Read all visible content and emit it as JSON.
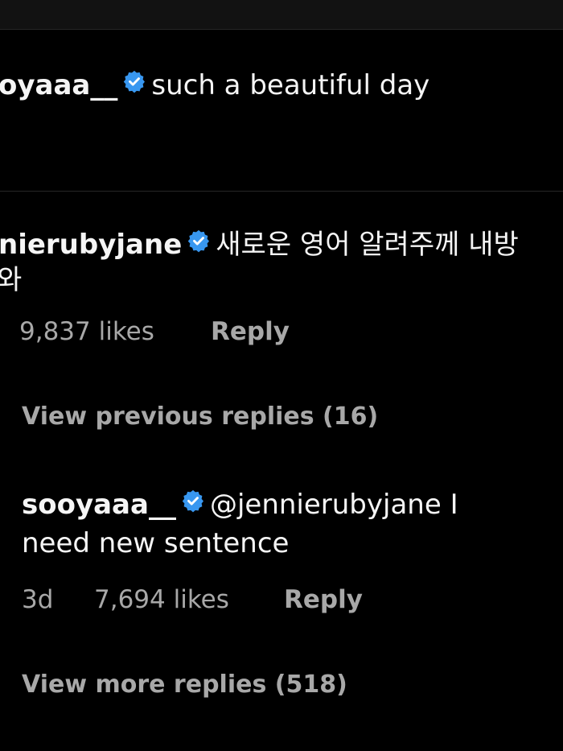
{
  "caption": {
    "username": "oyaaa__",
    "text": "such a beautiful day"
  },
  "comment": {
    "username": "nierubyjane",
    "text_line1": "새로운 영어 알려주께 내방",
    "text_line2": "와",
    "likes": "9,837 likes",
    "reply": "Reply",
    "view_previous": "View previous replies (16)"
  },
  "reply_item": {
    "username": "sooyaaa__",
    "mention": "@jennierubyjane",
    "text_line1_tail": " I",
    "text_line2": "need new sentence",
    "time": "3d",
    "likes": "7,694 likes",
    "reply": "Reply",
    "view_more": "View more replies (518)"
  },
  "colors": {
    "background": "#000000",
    "text": "#f5f5f5",
    "secondary": "#a8a8a8",
    "verified": "#3897f0",
    "divider": "#262626"
  },
  "icons": [
    "verified-badge-icon"
  ]
}
